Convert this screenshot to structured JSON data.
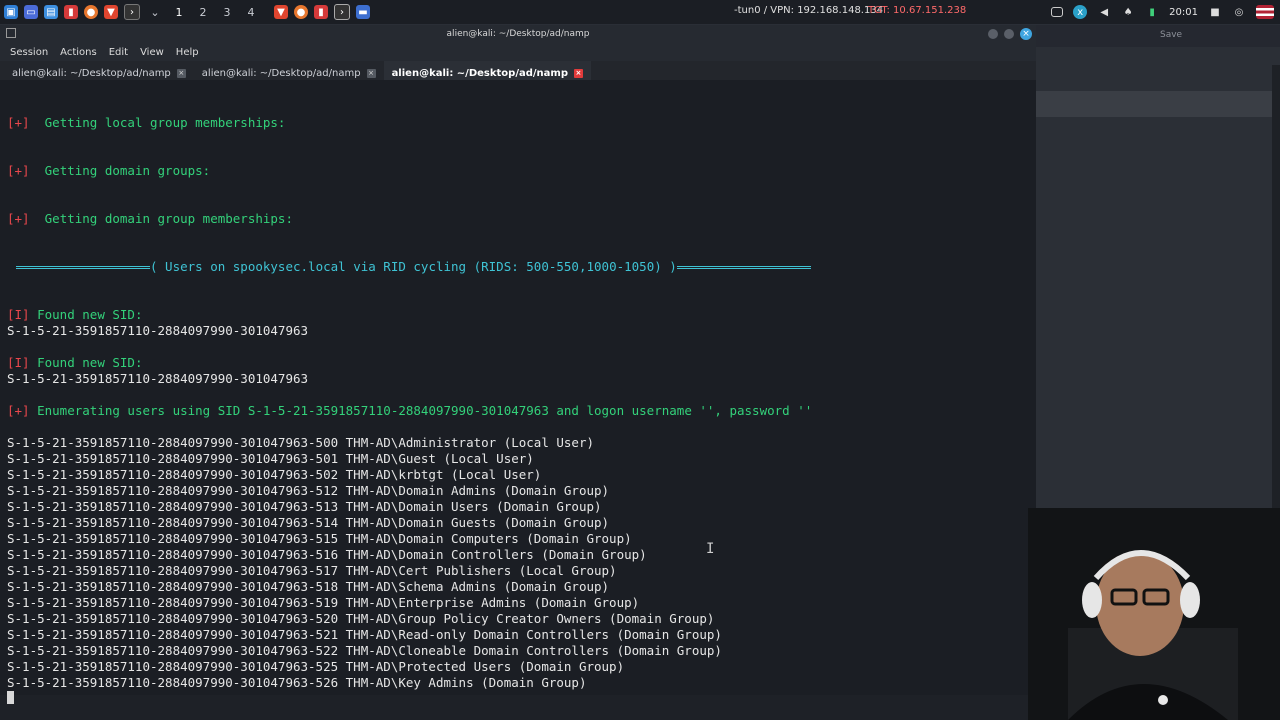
{
  "taskbar": {
    "workspaces": [
      "1",
      "2",
      "3",
      "4"
    ],
    "vpn": "-tun0 / VPN: 192.168.148.134",
    "tgt": "TGT: 10.67.151.238",
    "clock": "20:01"
  },
  "window": {
    "title": "alien@kali: ~/Desktop/ad/namp",
    "menu": [
      "Session",
      "Actions",
      "Edit",
      "View",
      "Help"
    ],
    "tabs": [
      "alien@kali: ~/Desktop/ad/namp",
      "alien@kali: ~/Desktop/ad/namp",
      "alien@kali: ~/Desktop/ad/namp"
    ],
    "active_tab": 2
  },
  "right_panel": {
    "save_label": "Save"
  },
  "terminal": {
    "header1": "Getting local group memberships:",
    "header2": "Getting domain groups:",
    "header3": "Getting domain group memberships:",
    "banner_text": "( Users on spookysec.local via RID cycling (RIDS: 500-550,1000-1050) )",
    "found_sid_label": "Found new SID:",
    "sid": "S-1-5-21-3591857110-2884097990-301047963",
    "enum_text": "Enumerating users using SID S-1-5-21-3591857110-2884097990-301047963 and logon username '', password ''",
    "mark_plus": "[+]",
    "mark_info": "[I]",
    "entries": [
      "S-1-5-21-3591857110-2884097990-301047963-500 THM-AD\\Administrator (Local User)",
      "S-1-5-21-3591857110-2884097990-301047963-501 THM-AD\\Guest (Local User)",
      "S-1-5-21-3591857110-2884097990-301047963-502 THM-AD\\krbtgt (Local User)",
      "S-1-5-21-3591857110-2884097990-301047963-512 THM-AD\\Domain Admins (Domain Group)",
      "S-1-5-21-3591857110-2884097990-301047963-513 THM-AD\\Domain Users (Domain Group)",
      "S-1-5-21-3591857110-2884097990-301047963-514 THM-AD\\Domain Guests (Domain Group)",
      "S-1-5-21-3591857110-2884097990-301047963-515 THM-AD\\Domain Computers (Domain Group)",
      "S-1-5-21-3591857110-2884097990-301047963-516 THM-AD\\Domain Controllers (Domain Group)",
      "S-1-5-21-3591857110-2884097990-301047963-517 THM-AD\\Cert Publishers (Local Group)",
      "S-1-5-21-3591857110-2884097990-301047963-518 THM-AD\\Schema Admins (Domain Group)",
      "S-1-5-21-3591857110-2884097990-301047963-519 THM-AD\\Enterprise Admins (Domain Group)",
      "S-1-5-21-3591857110-2884097990-301047963-520 THM-AD\\Group Policy Creator Owners (Domain Group)",
      "S-1-5-21-3591857110-2884097990-301047963-521 THM-AD\\Read-only Domain Controllers (Domain Group)",
      "S-1-5-21-3591857110-2884097990-301047963-522 THM-AD\\Cloneable Domain Controllers (Domain Group)",
      "S-1-5-21-3591857110-2884097990-301047963-525 THM-AD\\Protected Users (Domain Group)",
      "S-1-5-21-3591857110-2884097990-301047963-526 THM-AD\\Key Admins (Domain Group)"
    ]
  },
  "colors": {
    "bracket": "#e8474c",
    "green": "#33d17a",
    "cyan": "#3fc3d4",
    "tgt": "#ff6a6a"
  }
}
